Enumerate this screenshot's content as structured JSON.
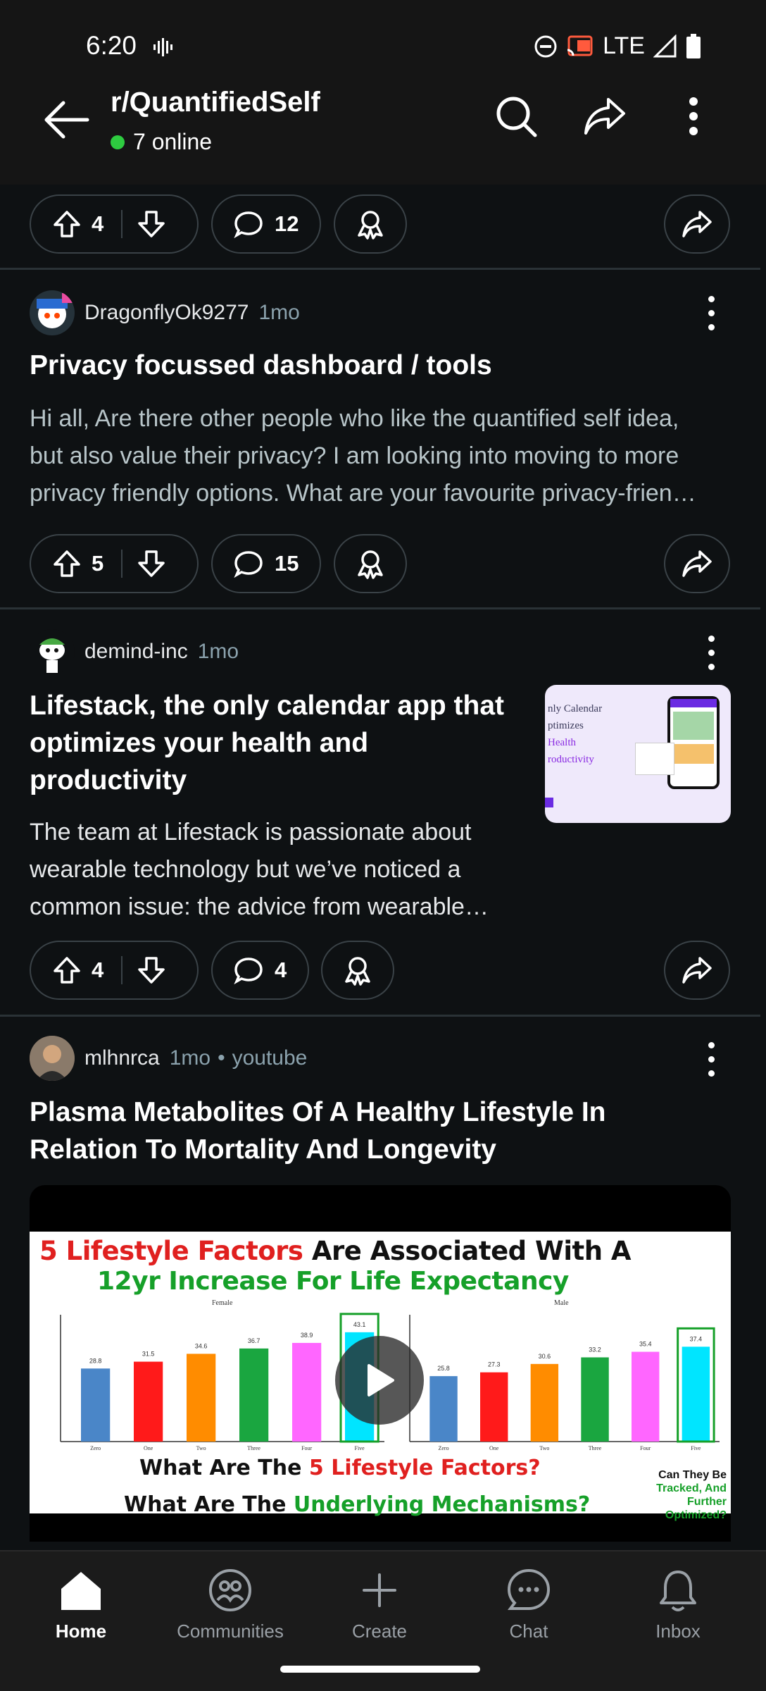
{
  "status": {
    "time": "6:20",
    "network": "LTE"
  },
  "header": {
    "subreddit": "r/QuantifiedSelf",
    "online": "7 online"
  },
  "posts": [
    {
      "upvotes": "4",
      "comments": "12"
    },
    {
      "author": "DragonflyOk9277",
      "age": "1mo",
      "title": "Privacy focussed dashboard / tools",
      "body_lines": [
        "Hi all, Are there other people who like the quantified self idea,",
        "but also value their privacy? I am looking into moving to more",
        "privacy friendly options. What are your favourite privacy-frien…"
      ],
      "upvotes": "5",
      "comments": "15"
    },
    {
      "author": "demind-inc",
      "age": "1mo",
      "title_lines": [
        "Lifestack, the only calendar app that",
        "optimizes your health and",
        "productivity"
      ],
      "body_lines": [
        "The team at Lifestack is passionate about",
        "wearable technology but we’ve noticed a",
        "common issue: the advice from wearable…"
      ],
      "thumb_lines": [
        "nly Calendar",
        "ptimizes",
        "Health",
        "roductivity"
      ],
      "upvotes": "4",
      "comments": "4"
    },
    {
      "author": "mlhnrca",
      "age": "1mo",
      "source": "youtube",
      "title_lines": [
        "Plasma Metabolites Of A Healthy Lifestyle In",
        "Relation To Mortality And Longevity"
      ],
      "video": {
        "headline_red": "5 Lifestyle Factors",
        "headline_rest": " Are Associated With A",
        "headline_green": "12yr Increase For Life Expectancy",
        "q1_pre": "What Are The ",
        "q1_red": "5 Lifestyle Factors?",
        "q2_pre": "What Are The ",
        "q2_green": "Underlying Mechanisms?",
        "side_black": "Can They Be",
        "side_green": "Tracked, And Further",
        "side_green2": "Optimized?",
        "panel_left": "Female",
        "panel_right": "Male"
      }
    }
  ],
  "chart_data": [
    {
      "type": "bar",
      "title": "Female",
      "categories": [
        "Zero",
        "One",
        "Two",
        "Three",
        "Four",
        "Five"
      ],
      "values": [
        28.8,
        31.5,
        34.6,
        36.7,
        38.9,
        43.1
      ],
      "ylim": [
        0,
        50
      ],
      "colors": [
        "#4a86c8",
        "#ff1a1a",
        "#ff8c00",
        "#1aa640",
        "#ff66ff",
        "#00e5ff"
      ]
    },
    {
      "type": "bar",
      "title": "Male",
      "categories": [
        "Zero",
        "One",
        "Two",
        "Three",
        "Four",
        "Five"
      ],
      "values": [
        25.8,
        27.3,
        30.6,
        33.2,
        35.4,
        37.4
      ],
      "ylim": [
        0,
        50
      ],
      "colors": [
        "#4a86c8",
        "#ff1a1a",
        "#ff8c00",
        "#1aa640",
        "#ff66ff",
        "#00e5ff"
      ]
    }
  ],
  "nav": [
    {
      "label": "Home"
    },
    {
      "label": "Communities"
    },
    {
      "label": "Create"
    },
    {
      "label": "Chat"
    },
    {
      "label": "Inbox"
    }
  ]
}
